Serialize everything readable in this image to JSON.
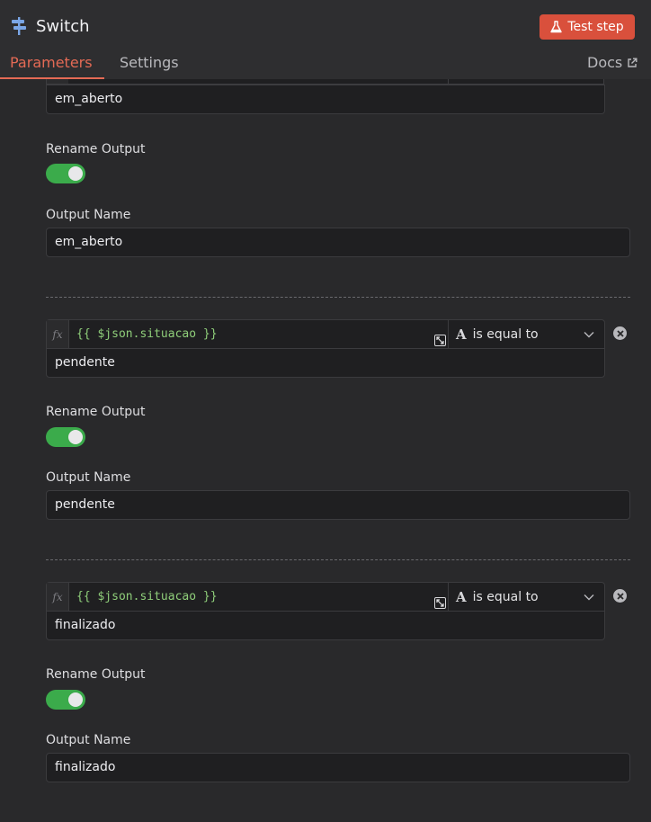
{
  "header": {
    "node_icon": "signpost-icon",
    "title": "Switch",
    "test_button": {
      "label": "Test step",
      "icon": "flask-icon"
    },
    "tabs": [
      {
        "label": "Parameters",
        "active": true
      },
      {
        "label": "Settings",
        "active": false
      }
    ],
    "docs": {
      "label": "Docs",
      "icon": "external-link-icon"
    },
    "accent_color": "#e46a55"
  },
  "rules": [
    {
      "value": "em_aberto",
      "rename_output_label": "Rename Output",
      "rename_output": true,
      "output_name_label": "Output Name",
      "output_name": "em_aberto"
    },
    {
      "fx_label": "fx",
      "left_value": "{{ $json.situacao }}",
      "operator": "is equal to",
      "value": "pendente",
      "rename_output_label": "Rename Output",
      "rename_output": true,
      "output_name_label": "Output Name",
      "output_name": "pendente"
    },
    {
      "fx_label": "fx",
      "left_value": "{{ $json.situacao }}",
      "operator": "is equal to",
      "value": "finalizado",
      "rename_output_label": "Rename Output",
      "rename_output": true,
      "output_name_label": "Output Name",
      "output_name": "finalizado"
    }
  ],
  "colors": {
    "toggle_on": "#3bab4b",
    "test_button": "#d9503c",
    "expression": "#8fce7a"
  }
}
